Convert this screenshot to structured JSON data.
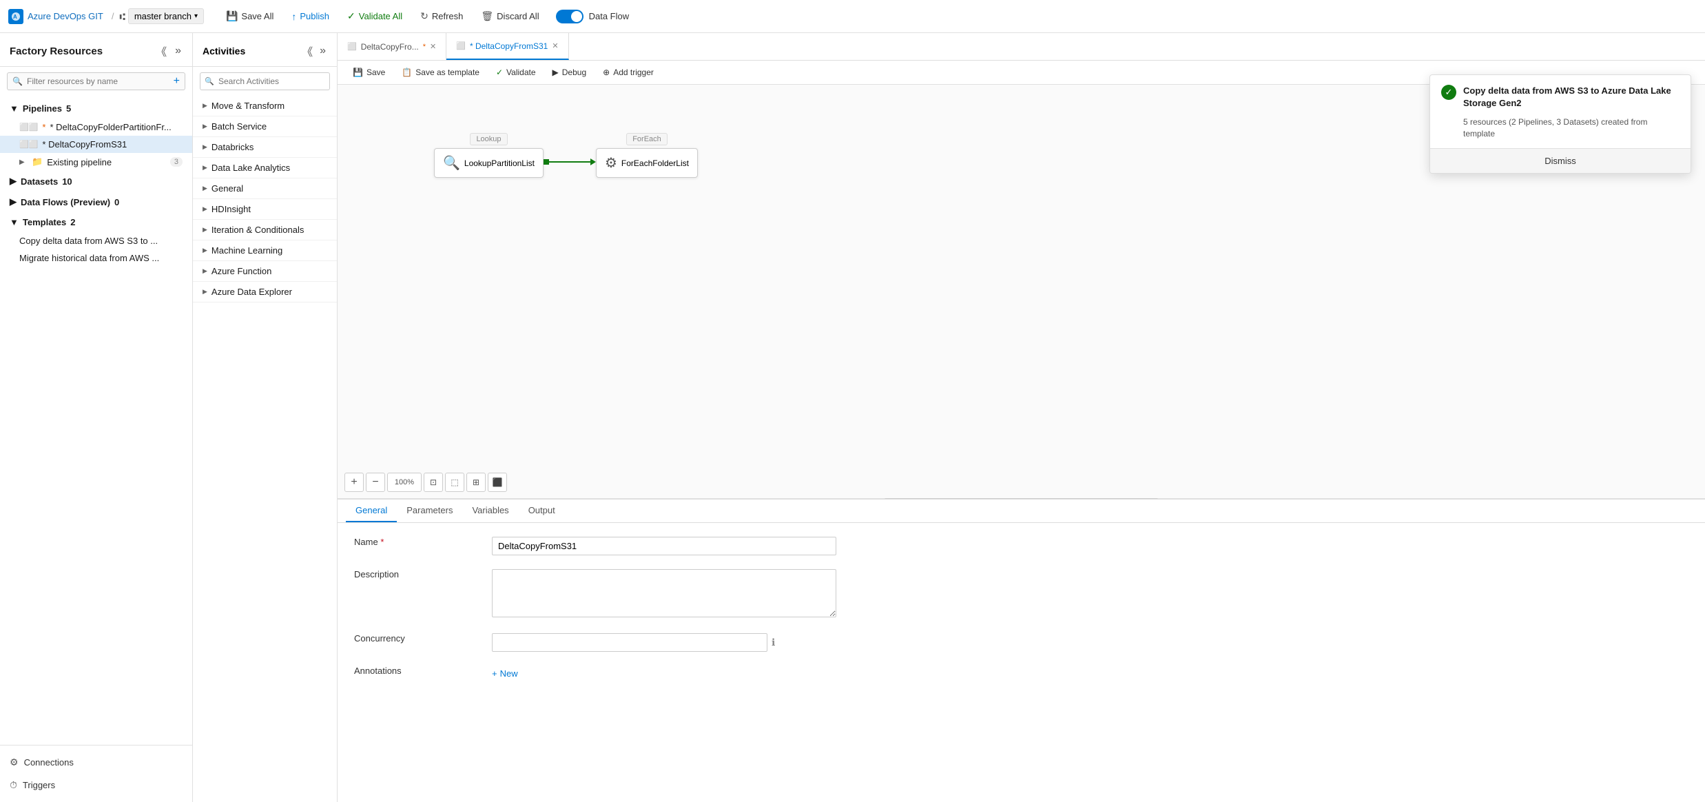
{
  "topbar": {
    "brand": "Azure DevOps GIT",
    "branch": "master branch",
    "actions": [
      {
        "id": "save-all",
        "label": "Save All",
        "icon": "💾"
      },
      {
        "id": "publish",
        "label": "Publish",
        "icon": "📤"
      },
      {
        "id": "validate-all",
        "label": "Validate All",
        "icon": "✓"
      },
      {
        "id": "refresh",
        "label": "Refresh",
        "icon": "↻"
      },
      {
        "id": "discard-all",
        "label": "Discard All",
        "icon": "🗑"
      }
    ],
    "toggle_label": "Data Flow"
  },
  "sidebar": {
    "title": "Factory Resources",
    "search_placeholder": "Filter resources by name",
    "sections": [
      {
        "id": "pipelines",
        "label": "Pipelines",
        "count": 5,
        "expanded": true,
        "items": [
          {
            "id": "pipeline1",
            "label": "* DeltaCopyFolderPartitionFr...",
            "active": false
          },
          {
            "id": "pipeline2",
            "label": "* DeltaCopyFromS31",
            "active": true
          }
        ],
        "subsections": [
          {
            "id": "existing",
            "label": "Existing pipeline",
            "count": 3
          }
        ]
      },
      {
        "id": "datasets",
        "label": "Datasets",
        "count": 10,
        "expanded": false
      },
      {
        "id": "dataflows",
        "label": "Data Flows (Preview)",
        "count": 0,
        "expanded": false
      },
      {
        "id": "templates",
        "label": "Templates",
        "count": 2,
        "expanded": true,
        "items": [
          {
            "id": "tpl1",
            "label": "Copy delta data from AWS S3 to ..."
          },
          {
            "id": "tpl2",
            "label": "Migrate historical data from AWS ..."
          }
        ]
      }
    ],
    "bottom_items": [
      {
        "id": "connections",
        "label": "Connections",
        "icon": "⚙"
      },
      {
        "id": "triggers",
        "label": "Triggers",
        "icon": "⏱"
      }
    ]
  },
  "activities": {
    "title": "Activities",
    "search_placeholder": "Search Activities",
    "groups": [
      {
        "id": "move-transform",
        "label": "Move & Transform"
      },
      {
        "id": "batch-service",
        "label": "Batch Service"
      },
      {
        "id": "databricks",
        "label": "Databricks"
      },
      {
        "id": "data-lake-analytics",
        "label": "Data Lake Analytics"
      },
      {
        "id": "general",
        "label": "General"
      },
      {
        "id": "hdinsight",
        "label": "HDInsight"
      },
      {
        "id": "iteration-conditionals",
        "label": "Iteration & Conditionals"
      },
      {
        "id": "machine-learning",
        "label": "Machine Learning"
      },
      {
        "id": "azure-function",
        "label": "Azure Function"
      },
      {
        "id": "azure-data-explorer",
        "label": "Azure Data Explorer"
      }
    ]
  },
  "pipeline_tabs": [
    {
      "id": "tab1",
      "label": "DeltaCopyFro...",
      "modified": true,
      "active": false
    },
    {
      "id": "tab2",
      "label": "* DeltaCopyFromS31",
      "modified": true,
      "active": true
    }
  ],
  "canvas_toolbar": {
    "buttons": [
      {
        "id": "save",
        "label": "Save",
        "icon": "💾"
      },
      {
        "id": "save-template",
        "label": "Save as template",
        "icon": "📋"
      },
      {
        "id": "validate",
        "label": "Validate",
        "icon": "✓"
      },
      {
        "id": "debug",
        "label": "Debug",
        "icon": "▶"
      },
      {
        "id": "add-trigger",
        "label": "Add trigger",
        "icon": "⊕"
      }
    ]
  },
  "pipeline_nodes": {
    "lookup_label": "Lookup",
    "lookup_node_label": "LookupPartitionList",
    "foreach_label": "ForEach",
    "foreach_node_label": "ForEachFolderList"
  },
  "bottom_panel": {
    "tabs": [
      {
        "id": "general",
        "label": "General",
        "active": true
      },
      {
        "id": "parameters",
        "label": "Parameters"
      },
      {
        "id": "variables",
        "label": "Variables"
      },
      {
        "id": "output",
        "label": "Output"
      }
    ],
    "name_label": "Name",
    "name_value": "DeltaCopyFromS31",
    "description_label": "Description",
    "description_value": "",
    "concurrency_label": "Concurrency",
    "annotations_label": "Annotations",
    "annotations_btn": "New"
  },
  "toast": {
    "title": "Copy delta data from AWS S3 to Azure Data Lake Storage Gen2",
    "description": "5 resources (2 Pipelines, 3 Datasets) created from template",
    "dismiss_label": "Dismiss"
  },
  "zoom_controls": {
    "plus": "+",
    "minus": "−",
    "percent": "100%"
  }
}
